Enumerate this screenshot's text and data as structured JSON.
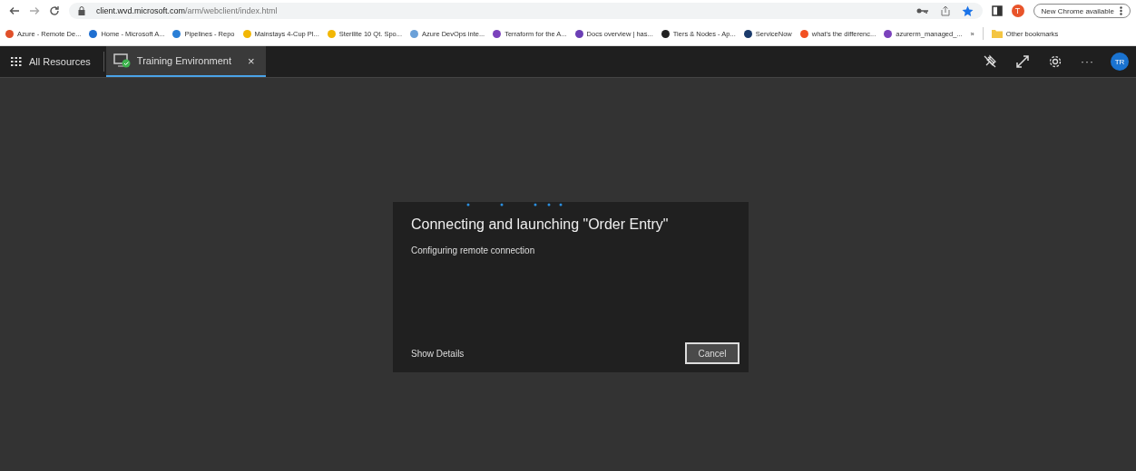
{
  "browser": {
    "url_host": "client.wvd.microsoft.com",
    "url_path": "/arm/webclient/index.html",
    "profile_initial": "T",
    "update_button": "New Chrome available",
    "bookmarks": [
      {
        "label": "Azure - Remote De...",
        "color": "#e0502a"
      },
      {
        "label": "Home - Microsoft A...",
        "color": "#1f6fd1"
      },
      {
        "label": "Pipelines - Repo",
        "color": "#2a7fd6"
      },
      {
        "label": "Mainstays 4-Cup Pl...",
        "color": "#f2b705"
      },
      {
        "label": "Sterilite 10 Qt. Spo...",
        "color": "#f2b705"
      },
      {
        "label": "Azure DevOps inte...",
        "color": "#6aa0d8"
      },
      {
        "label": "Terraform for the A...",
        "color": "#7b42bc"
      },
      {
        "label": "Docs overview | has...",
        "color": "#6b3fb5"
      },
      {
        "label": "Tiers & Nodes - Ap...",
        "color": "#222222"
      },
      {
        "label": "ServiceNow",
        "color": "#1a3a6b"
      },
      {
        "label": "what's the differenc...",
        "color": "#f25022"
      },
      {
        "label": "azurerm_managed_...",
        "color": "#7b42bc"
      }
    ],
    "overflow": "»",
    "other_bookmarks": "Other bookmarks"
  },
  "app_bar": {
    "all_resources": "All Resources",
    "tabs": [
      {
        "label": "Training Environment",
        "selected": true,
        "close": "×"
      }
    ],
    "avatar": "TR",
    "more": "···"
  },
  "dialog": {
    "title": "Connecting and launching \"Order Entry\"",
    "status": "Configuring remote connection",
    "details_link": "Show Details",
    "cancel_button": "Cancel"
  }
}
